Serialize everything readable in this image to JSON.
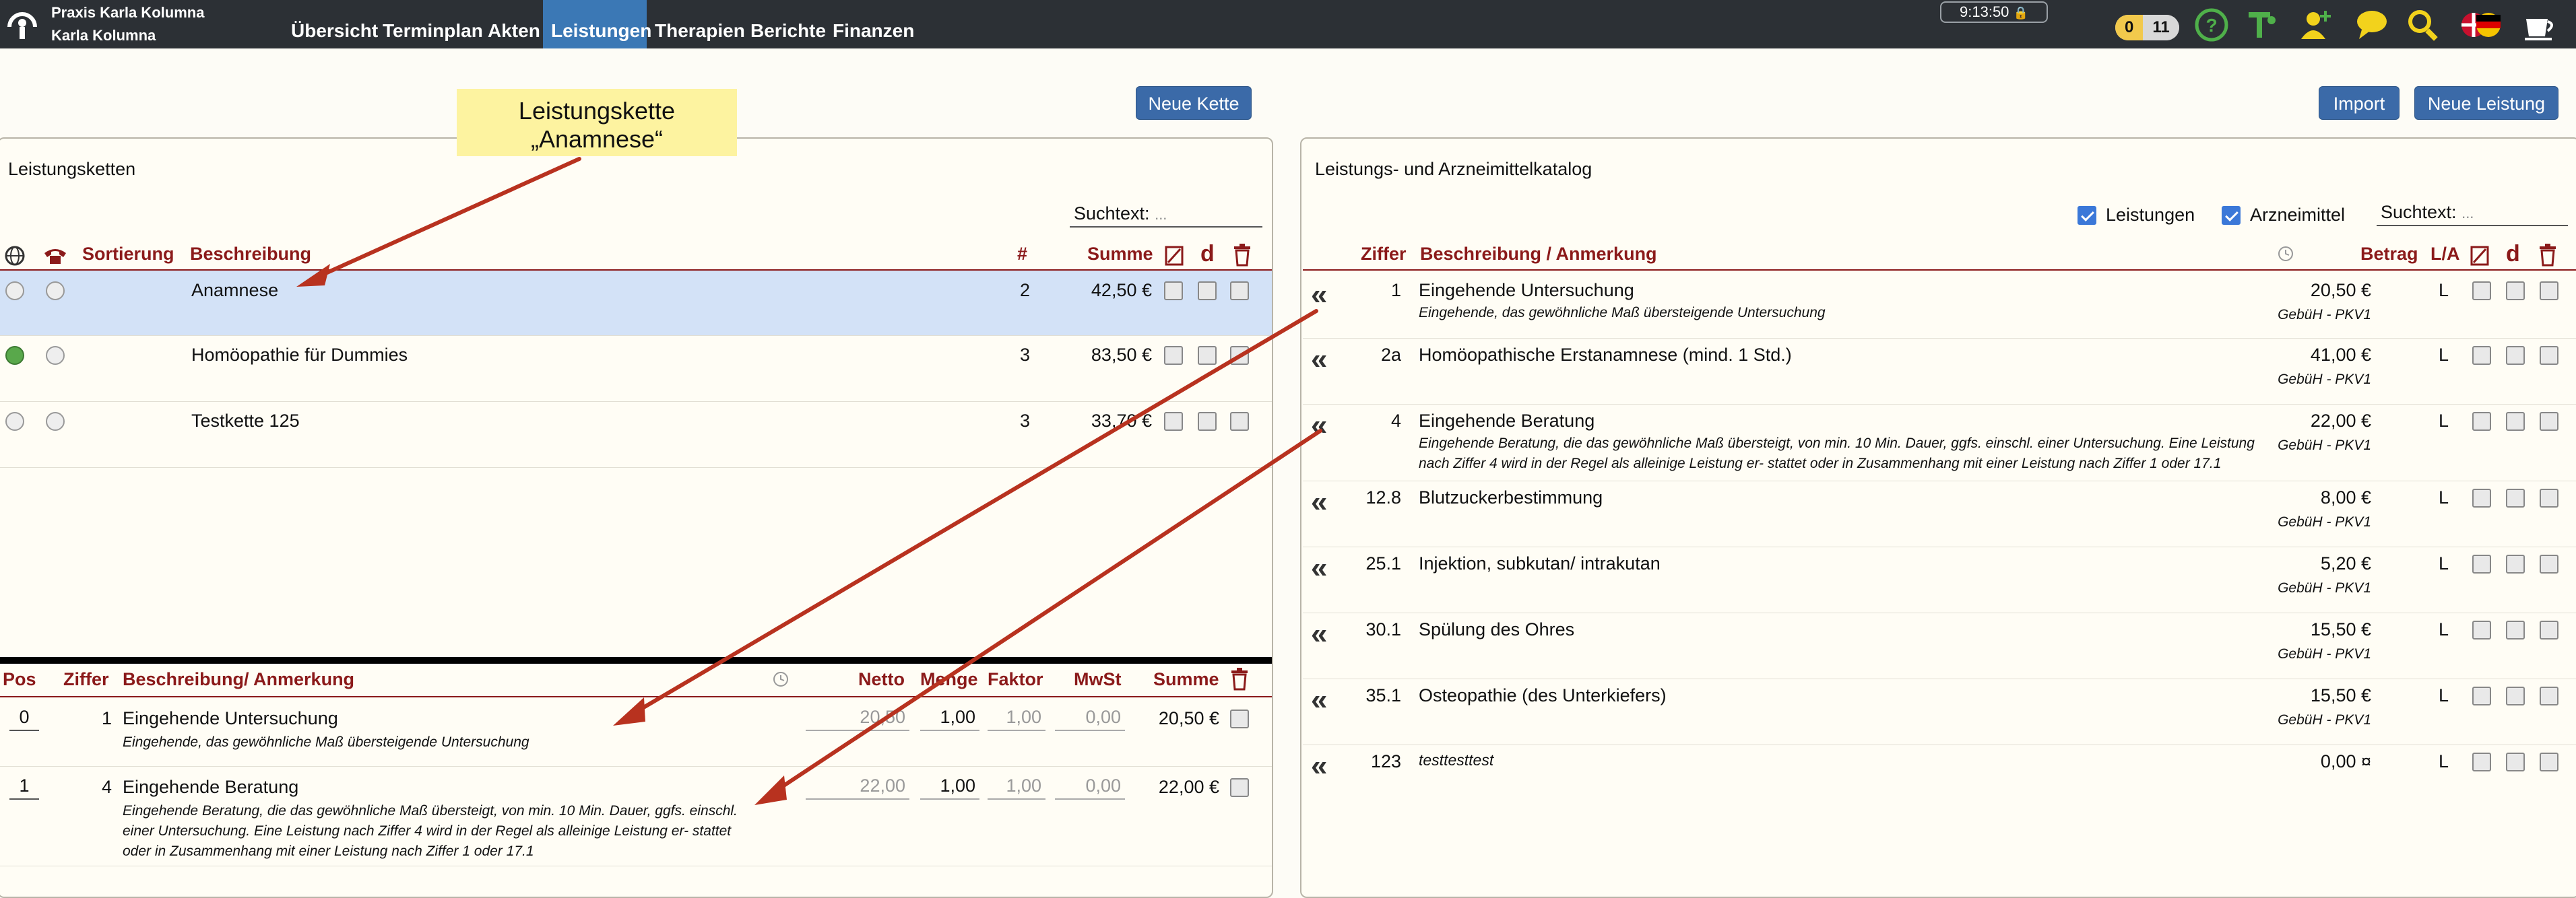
{
  "header": {
    "practice_line1": "Praxis Karla Kolumna",
    "practice_line2": "Karla Kolumna",
    "nav": [
      "Übersicht",
      "Terminplan",
      "Akten",
      "Leistungen",
      "Therapien",
      "Berichte",
      "Finanzen"
    ],
    "active_nav": "Leistungen",
    "clock": "9:13:50",
    "counter_a": "0",
    "counter_b": "11",
    "icons": [
      "logo-icon",
      "lock-icon",
      "help-icon",
      "tools-icon",
      "add-user-icon",
      "chat-icon",
      "search-icon",
      "flags-icon",
      "coffee-icon"
    ]
  },
  "buttons": {
    "neue_kette": "Neue Kette",
    "import": "Import",
    "neue_leistung": "Neue Leistung"
  },
  "callout": {
    "line1": "Leistungskette",
    "line2": "„Anamnese“"
  },
  "chains": {
    "title": "Leistungsketten",
    "search_label": "Suchtext:",
    "search_placeholder": "...",
    "headers": {
      "sort": "Sortierung",
      "desc": "Beschreibung",
      "count": "#",
      "sum": "Summe"
    },
    "rows": [
      {
        "name": "Anamnese",
        "count": "2",
        "sum": "42,50 €",
        "web": "off",
        "selected": true
      },
      {
        "name": "Homöopathie für Dummies",
        "count": "3",
        "sum": "83,50 €",
        "web": "on",
        "selected": false
      },
      {
        "name": "Testkette 125",
        "count": "3",
        "sum": "33,70 €",
        "web": "off",
        "selected": false
      }
    ]
  },
  "chain_items": {
    "headers": {
      "pos": "Pos",
      "ziffer": "Ziffer",
      "desc": "Beschreibung/ Anmerkung",
      "netto": "Netto",
      "menge": "Menge",
      "faktor": "Faktor",
      "mwst": "MwSt",
      "summe": "Summe"
    },
    "rows": [
      {
        "pos": "0",
        "ziffer": "1",
        "title": "Eingehende Untersuchung",
        "note": "Eingehende, das gewöhnliche Maß übersteigende Untersuchung",
        "netto": "20,50",
        "menge": "1,00",
        "faktor": "1,00",
        "mwst": "0,00",
        "summe": "20,50 €"
      },
      {
        "pos": "1",
        "ziffer": "4",
        "title": "Eingehende Beratung",
        "note": "Eingehende Beratung, die das gewöhnliche Maß übersteigt, von min. 10 Min. Dauer, ggfs. einschl. einer Untersuchung. Eine Leistung nach Ziffer 4 wird in der Regel als alleinige Leistung er- stattet oder in Zusammenhang mit einer Leistung nach Ziffer 1 oder 17.1",
        "netto": "22,00",
        "menge": "1,00",
        "faktor": "1,00",
        "mwst": "0,00",
        "summe": "22,00 €"
      }
    ]
  },
  "catalog": {
    "title": "Leistungs- und Arzneimittelkatalog",
    "filter_leistungen": "Leistungen",
    "filter_arzneimittel": "Arzneimittel",
    "search_label": "Suchtext:",
    "search_placeholder": "...",
    "headers": {
      "ziffer": "Ziffer",
      "desc": "Beschreibung / Anmerkung",
      "betrag": "Betrag",
      "la": "L/A"
    },
    "rows": [
      {
        "ziffer": "1",
        "title": "Eingehende Untersuchung",
        "note": "Eingehende, das gewöhnliche Maß übersteigende Untersuchung",
        "betrag": "20,50 €",
        "tariff": "GebüH - PKV1",
        "la": "L"
      },
      {
        "ziffer": "2a",
        "title": "Homöopathische Erstanamnese (mind. 1 Std.)",
        "note": "",
        "betrag": "41,00 €",
        "tariff": "GebüH - PKV1",
        "la": "L"
      },
      {
        "ziffer": "4",
        "title": "Eingehende Beratung",
        "note": "Eingehende Beratung, die das gewöhnliche Maß übersteigt, von min. 10 Min. Dauer, ggfs. einschl. einer Untersuchung. Eine Leistung nach Ziffer 4 wird in der Regel als alleinige Leistung er- stattet oder in Zusammenhang mit einer Leistung nach Ziffer 1 oder 17.1",
        "betrag": "22,00 €",
        "tariff": "GebüH - PKV1",
        "la": "L"
      },
      {
        "ziffer": "12.8",
        "title": "Blutzuckerbestimmung",
        "note": "",
        "betrag": "8,00 €",
        "tariff": "GebüH - PKV1",
        "la": "L"
      },
      {
        "ziffer": "25.1",
        "title": "Injektion, subkutan/ intrakutan",
        "note": "",
        "betrag": "5,20 €",
        "tariff": "GebüH - PKV1",
        "la": "L"
      },
      {
        "ziffer": "30.1",
        "title": "Spülung des Ohres",
        "note": "",
        "betrag": "15,50 €",
        "tariff": "GebüH - PKV1",
        "la": "L"
      },
      {
        "ziffer": "35.1",
        "title": "Osteopathie (des Unterkiefers)",
        "note": "",
        "betrag": "15,50 €",
        "tariff": "GebüH - PKV1",
        "la": "L"
      },
      {
        "ziffer": "123",
        "title": "testtesttest",
        "note": "",
        "betrag": "0,00 ¤",
        "tariff": "",
        "la": "L"
      }
    ]
  }
}
